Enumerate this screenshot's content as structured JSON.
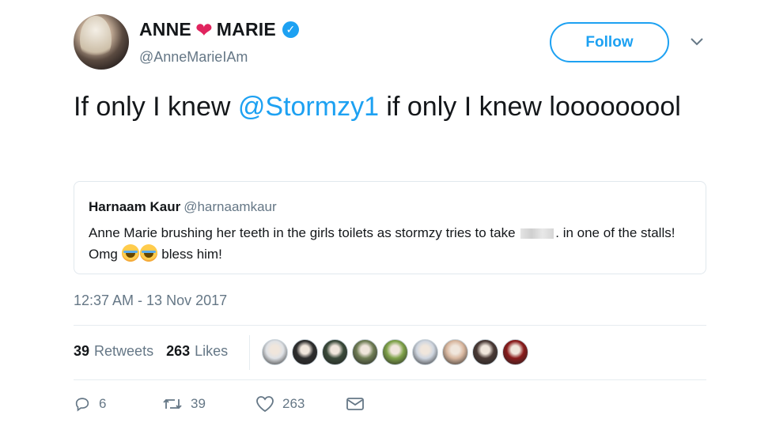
{
  "author": {
    "name_part1": "ANNE",
    "name_heart": "❤",
    "name_part2": "MARIE",
    "verified_glyph": "✓",
    "handle": "@AnneMarieIAm",
    "avatar_icon": "profile-photo"
  },
  "header": {
    "follow_label": "Follow",
    "caret_glyph": "⌄"
  },
  "tweet": {
    "text_before": "If only I knew ",
    "mention": "@Stormzy1",
    "text_after": " if only I knew looooooool"
  },
  "quote": {
    "name": "Harnaam Kaur",
    "handle": "@harnaamkaur",
    "text_part1": "Anne Marie brushing her teeth in the girls toilets as stormzy tries to take ",
    "text_part2": ". in one of the stalls! Omg ",
    "text_part3": " bless him!",
    "emoji_names": [
      "joy-emoji",
      "joy-emoji"
    ]
  },
  "timestamp": "12:37 AM - 13 Nov 2017",
  "stats": {
    "retweets_count": "39",
    "retweets_label": "Retweets",
    "likes_count": "263",
    "likes_label": "Likes"
  },
  "likers": [
    {
      "name": "liker-avatar-1",
      "color": "#dfe2e6"
    },
    {
      "name": "liker-avatar-2",
      "color": "#2e2e2e"
    },
    {
      "name": "liker-avatar-3",
      "color": "#3a4a3a"
    },
    {
      "name": "liker-avatar-4",
      "color": "#6f7d55"
    },
    {
      "name": "liker-avatar-5",
      "color": "#7fa24a"
    },
    {
      "name": "liker-avatar-6",
      "color": "#cfd6e0"
    },
    {
      "name": "liker-avatar-7",
      "color": "#d9b8a0"
    },
    {
      "name": "liker-avatar-8",
      "color": "#4a3a36"
    },
    {
      "name": "liker-avatar-9",
      "color": "#8a1c1c"
    }
  ],
  "actions": {
    "reply_count": "6",
    "retweet_count": "39",
    "like_count": "263"
  },
  "colors": {
    "accent": "#1da1f2",
    "heart": "#e0245e",
    "muted": "#657786"
  }
}
